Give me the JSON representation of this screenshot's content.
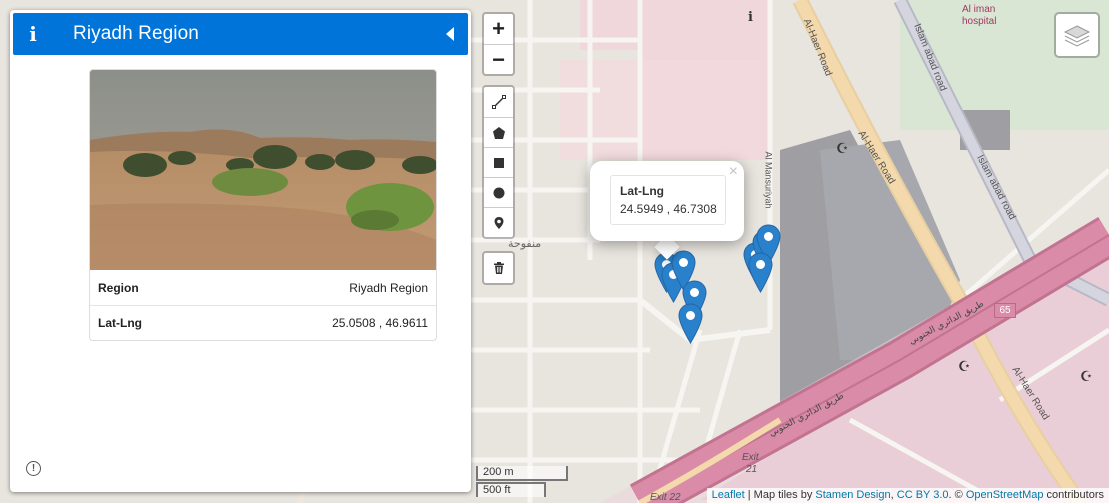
{
  "sidebar": {
    "title": "Riyadh Region",
    "info_icon": "info-icon",
    "collapse_icon": "caret-left-icon",
    "footer_icon": "alert-circle-icon",
    "card": {
      "rows": [
        {
          "key": "Region",
          "value": "Riyadh Region"
        },
        {
          "key": "Lat-Lng",
          "value": "25.0508 , 46.9611"
        }
      ]
    }
  },
  "zoom": {
    "in": "+",
    "out": "−"
  },
  "draw_tools": [
    "polyline-icon",
    "polygon-icon",
    "rectangle-icon",
    "circle-icon",
    "marker-icon"
  ],
  "delete_icon": "trash-icon",
  "layers_icon": "layers-icon",
  "popup": {
    "key": "Lat-Lng",
    "value": "24.5949 , 46.7308",
    "close": "×"
  },
  "scale": {
    "metric": "200 m",
    "imperial": "500 ft"
  },
  "attribution": {
    "leaflet": "Leaflet",
    "sep1": " | Map tiles by ",
    "stamen": "Stamen Design",
    "sep2": ", ",
    "cc": "CC BY 3.0",
    "sep3": ". © ",
    "osm": "OpenStreetMap",
    "contributors": " contributors"
  },
  "map_labels": {
    "road1": "Al-Haer Road",
    "road2": "Al-Haer Road",
    "road3": "Al-Haer Road",
    "road4": "Islam abad road",
    "road5": "Islam abad road",
    "road6": "Al Mansuriyah",
    "hospital_1": "Al iman",
    "hospital_2": "hospital",
    "arabic_area": "منفوحة",
    "arabic_road1": "طريق الدائري الجنوبي",
    "arabic_road2": "طريق الدائري الجنوبي",
    "shield": "65",
    "exit21": "Exit",
    "exit21b": "21",
    "exit22": "Exit 22"
  },
  "colors": {
    "header": "#0074d9",
    "marker": "#2a81cb",
    "road": "#f3d6a6",
    "highway": "#e08fb0"
  }
}
